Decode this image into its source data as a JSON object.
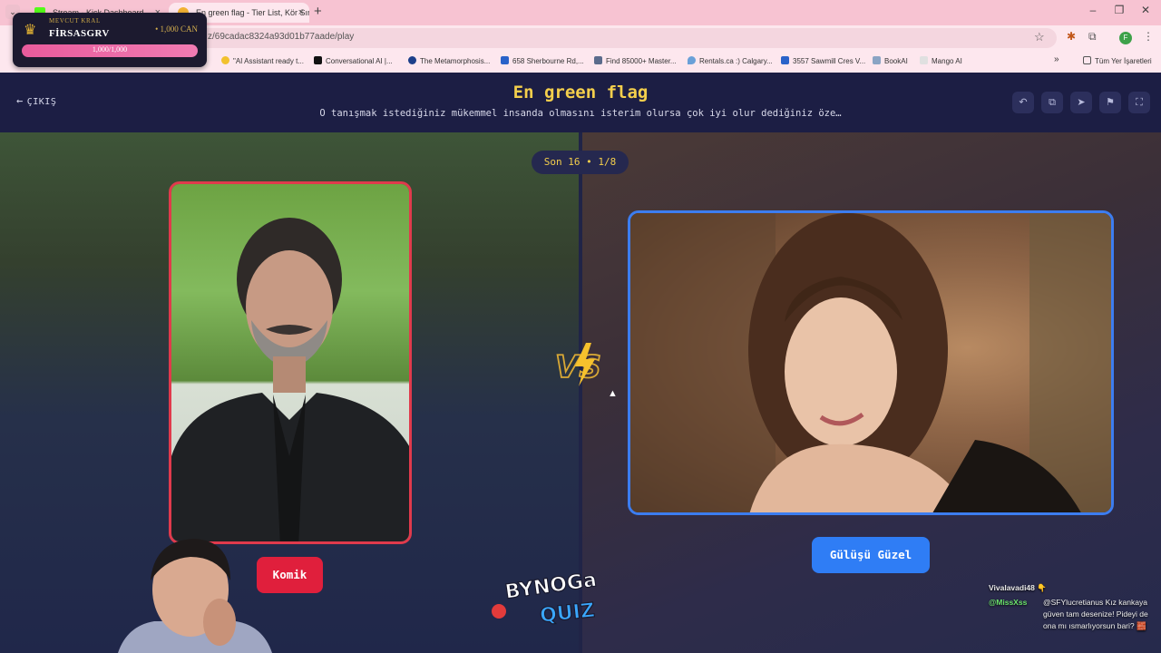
{
  "browser": {
    "tabs": [
      {
        "label": "Stream - Kick Dashboard",
        "active": false
      },
      {
        "label": "En green flag - Tier List, Kör Sır...",
        "active": true
      }
    ],
    "url": "z/69cadac8324a93d01b77aade/play",
    "bookmarks": [
      "\"AI Assistant ready t...",
      "Conversational AI |...",
      "The Metamorphosis...",
      "658 Sherbourne Rd,...",
      "Find 85000+ Master...",
      "Rentals.ca :) Calgary...",
      "3557 Sawmill Cres V...",
      "BookAI",
      "Mango AI"
    ],
    "all_bookmarks": "Tüm Yer İşaretleri",
    "profile_initial": "F"
  },
  "overlay": {
    "subtitle": "MEVCUT KRAL",
    "name": "FİRSASGRV",
    "currency": "• 1,000 CAN",
    "bar_label": "1,000/1,000",
    "bar_fraction": 1.0
  },
  "app": {
    "exit_label": "ÇIKIŞ",
    "title": "En green flag",
    "subtitle": "O tanışmak istediğiniz mükemmel insanda olmasını isterim olursa çok iyi olur dediğiniz öze…",
    "round_badge": "Son 16 • 1/8",
    "left_option": "Komik",
    "right_option": "Gülüşü Güzel",
    "vs_text": "VS",
    "logo_top": "BYNOGa",
    "logo_bottom": "QUIZ"
  },
  "chat": [
    {
      "user": "Vivalavadi48",
      "text": "👇"
    },
    {
      "user": "@MissXss",
      "text": "@SFYlucretianus Kız kankaya güven tam desenize! Pideyi de ona mı ısmarlıyorsun bari? 🧱"
    }
  ],
  "colors": {
    "accent_yellow": "#f4cf4c",
    "left_red": "#e01f3c",
    "right_blue": "#2f7df5",
    "header_bg": "#1c1e44"
  }
}
